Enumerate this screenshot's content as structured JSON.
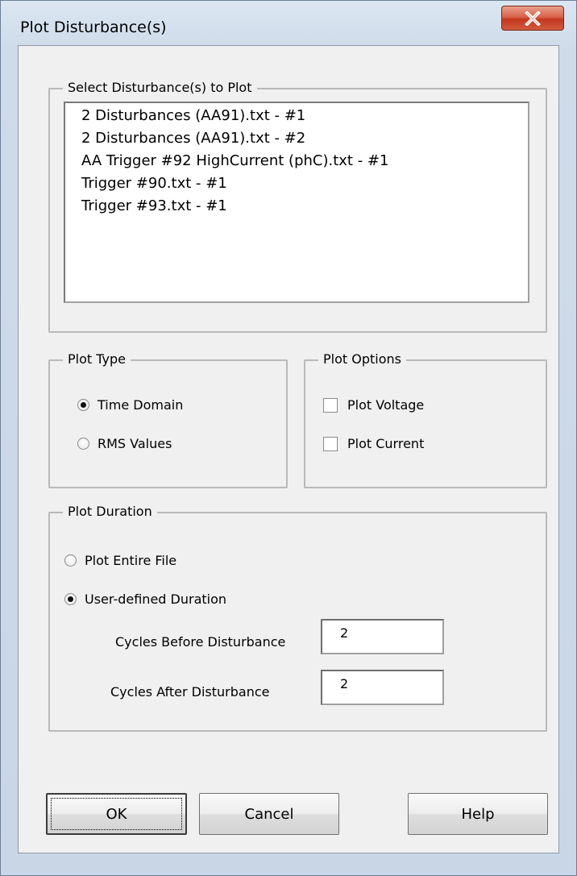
{
  "window": {
    "title": "Plot Disturbance(s)",
    "close_glyph": "✕"
  },
  "select_group": {
    "legend": "Select Disturbance(s) to Plot",
    "items": [
      "2 Disturbances (AA91).txt  -  #1",
      "2 Disturbances (AA91).txt  -  #2",
      "AA Trigger #92 HighCurrent (phC).txt  -  #1",
      "Trigger #90.txt  -  #1",
      "Trigger #93.txt  -  #1"
    ]
  },
  "plot_type": {
    "legend": "Plot Type",
    "time_domain": {
      "label": "Time Domain",
      "checked": true
    },
    "rms_values": {
      "label": "RMS Values",
      "checked": false
    }
  },
  "plot_options": {
    "legend": "Plot Options",
    "plot_voltage": {
      "label": "Plot Voltage",
      "checked": false
    },
    "plot_current": {
      "label": "Plot Current",
      "checked": false
    }
  },
  "plot_duration": {
    "legend": "Plot Duration",
    "entire_file": {
      "label": "Plot Entire File",
      "checked": false
    },
    "user_defined": {
      "label": "User-defined Duration",
      "checked": true
    },
    "cycles_before": {
      "label": "Cycles Before Disturbance",
      "value": "2"
    },
    "cycles_after": {
      "label": "Cycles After Disturbance",
      "value": "2"
    }
  },
  "buttons": {
    "ok": "OK",
    "cancel": "Cancel",
    "help": "Help"
  },
  "colors": {
    "close_button": "#d9634a",
    "dialog_bg": "#f0f0f0",
    "frame": "#cfdbe9"
  },
  "icons": {
    "close": "close-icon"
  }
}
